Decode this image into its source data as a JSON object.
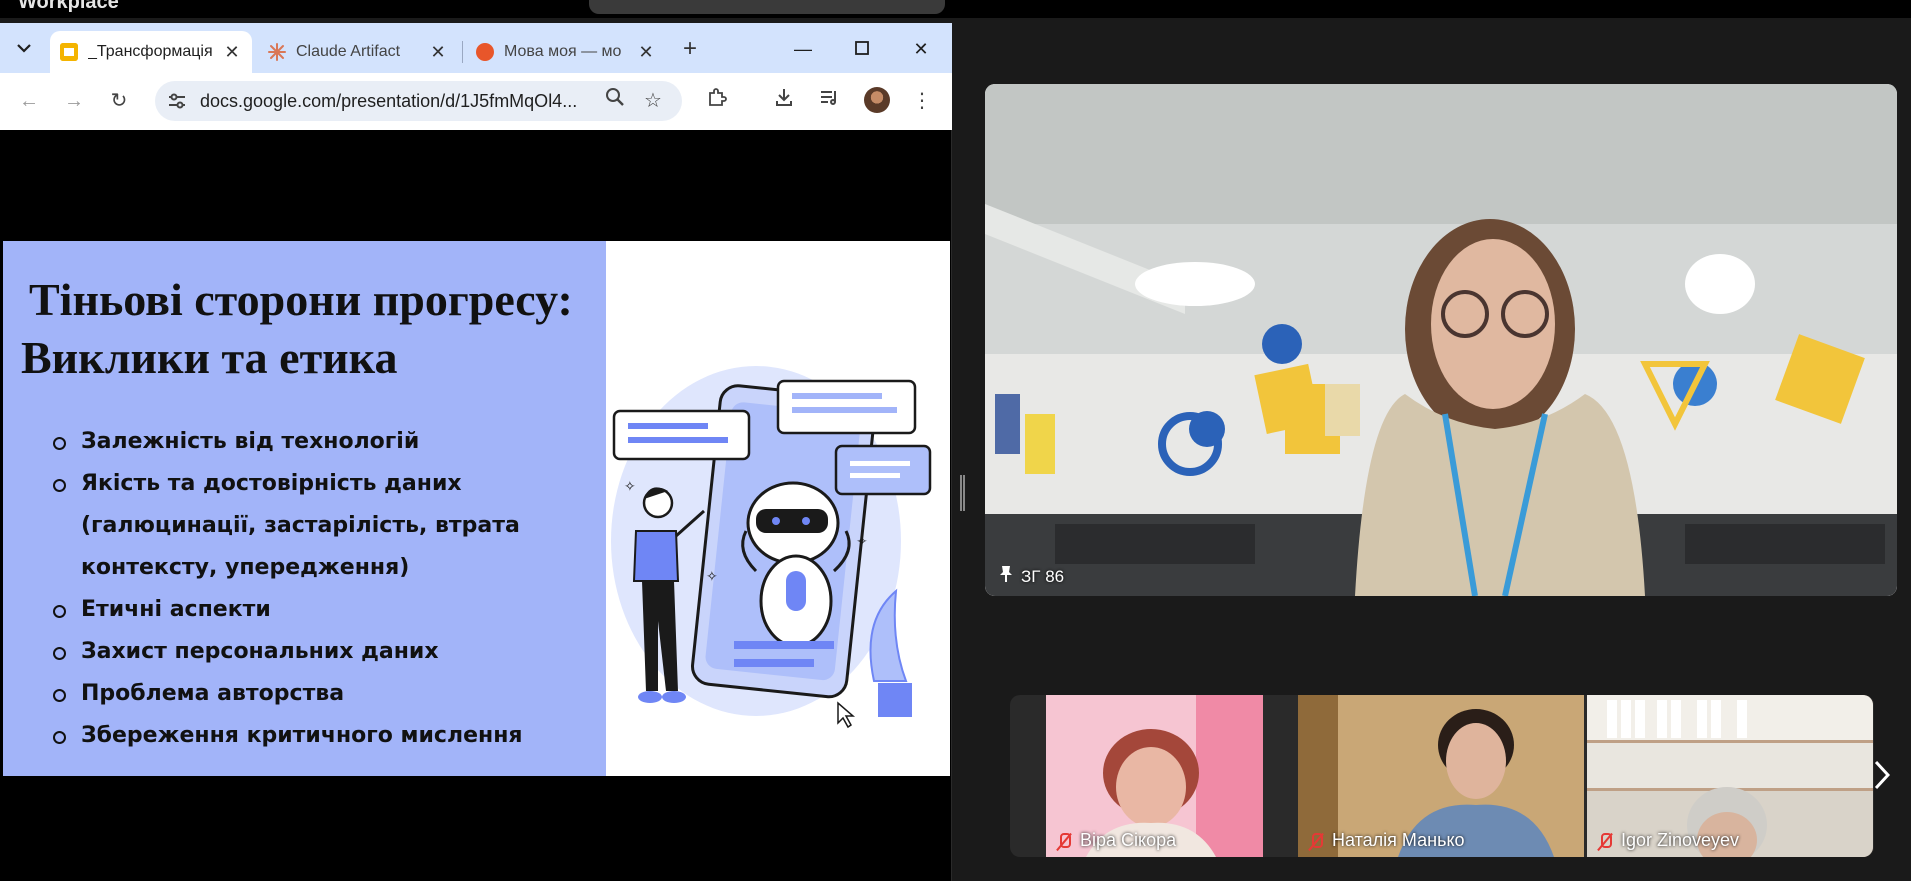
{
  "app": {
    "label": "Workplace"
  },
  "browser": {
    "tabs": [
      {
        "title": "_Трансформація",
        "active": true,
        "favicon_color": "#f4b400"
      },
      {
        "title": "Claude Artifact",
        "active": false,
        "favicon_color": "#d97757"
      },
      {
        "title": "Мова моя — мо",
        "active": false,
        "favicon_color": "#e8562a"
      }
    ],
    "url": "docs.google.com/presentation/d/1J5fmMqOl4..."
  },
  "slide": {
    "title_line1": "Тіньові сторони прогресу:",
    "title_line2": "Виклики та етика",
    "bullets": [
      "Залежність від технологій",
      "Якість та достовірність даних (галюцинації, застарілість, втрата контексту, упередження)",
      "Етичні аспекти",
      "Захист персональних даних",
      "Проблема авторства",
      "Збереження критичного мислення"
    ],
    "left_bg": "#a2b4f9"
  },
  "meeting": {
    "main_speaker_label": "ЗГ 86",
    "participants": [
      {
        "name": "Віра Сікора",
        "muted": true
      },
      {
        "name": "Наталія Манько",
        "muted": true
      },
      {
        "name": "Igor Zinoveyev",
        "muted": true
      }
    ]
  },
  "icons": {
    "tab_menu": "chevron-down-icon",
    "back": "arrow-left-icon",
    "forward": "arrow-right-icon",
    "reload": "reload-icon",
    "site_info": "tune-icon",
    "zoom": "magnifier-icon",
    "bookmark": "star-icon",
    "extensions": "puzzle-icon",
    "download": "download-icon",
    "media": "media-queue-icon",
    "menu": "kebab-icon"
  }
}
